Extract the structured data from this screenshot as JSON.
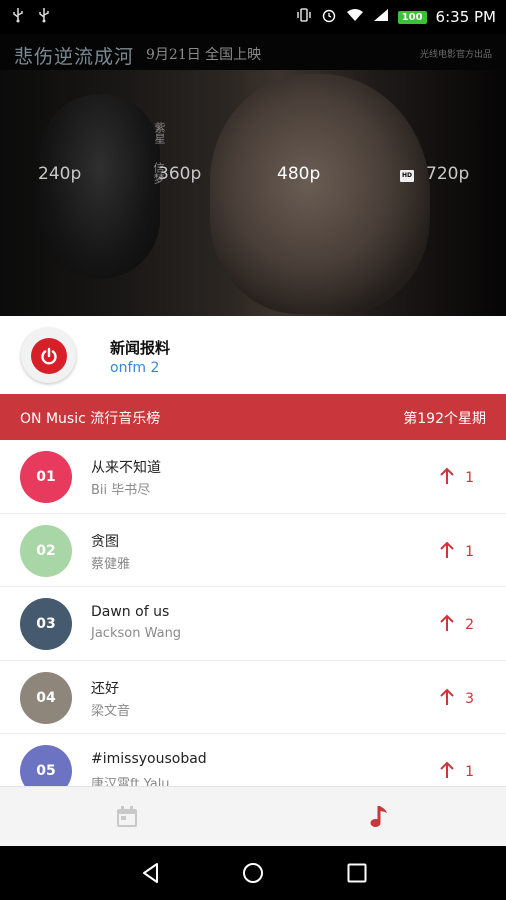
{
  "status_bar": {
    "time": "6:35 PM",
    "battery": "100",
    "left_icons": [
      "usb-icon",
      "usb-icon"
    ],
    "right_icons": [
      "vibrate-icon",
      "alarm-icon",
      "wifi-icon",
      "signal-icon",
      "battery-icon"
    ]
  },
  "video": {
    "poster_title": "悲伤逆流成河",
    "poster_date": "9月21日 全国上映",
    "poster_small": "光线电影官方出品",
    "side_text_1": "紫星",
    "side_text_2": "信梦",
    "resolutions": [
      {
        "label": "240p",
        "active": false
      },
      {
        "label": "360p",
        "active": false
      },
      {
        "label": "480p",
        "active": true
      },
      {
        "label": "720p",
        "active": false
      }
    ],
    "hd_badge": "HD"
  },
  "station": {
    "name": "新闻报料",
    "subtitle": "onfm 2",
    "logo_icon": "power-icon"
  },
  "chart_header": {
    "title": "ON Music 流行音乐榜",
    "week": "第192个星期"
  },
  "songs": [
    {
      "rank": "01",
      "title": "从来不知道",
      "artist": "Bii 毕书尽",
      "change": "1",
      "color": "#e83a5c"
    },
    {
      "rank": "02",
      "title": "贪图",
      "artist": "蔡健雅",
      "change": "1",
      "color": "#a9d6a6"
    },
    {
      "rank": "03",
      "title": "Dawn of us",
      "artist": "Jackson Wang",
      "change": "2",
      "color": "#455a6e"
    },
    {
      "rank": "04",
      "title": "还好",
      "artist": "梁文音",
      "change": "3",
      "color": "#8f867b"
    },
    {
      "rank": "05",
      "title": "#imissyousobad",
      "artist": "唐汉霄ft Yalu",
      "change": "1",
      "color": "#6b73c2"
    }
  ],
  "tabs": {
    "calendar_icon": "calendar-icon",
    "music_icon": "music-note-icon",
    "inactive_color": "#c9c9c9",
    "active_color": "#c9363b"
  },
  "nav": {
    "back_icon": "back-icon",
    "home_icon": "home-icon",
    "recents_icon": "recents-icon"
  }
}
